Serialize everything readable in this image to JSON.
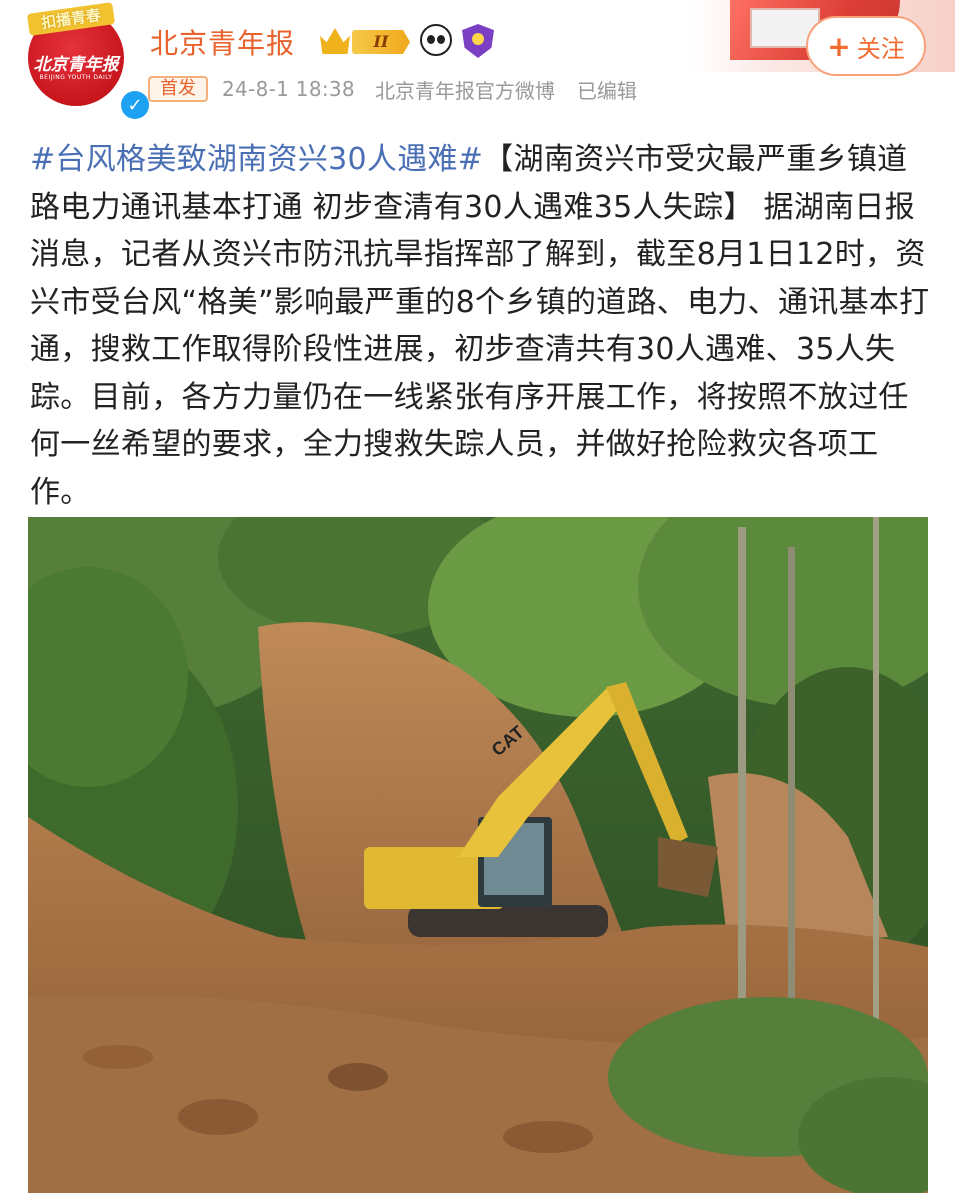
{
  "account": {
    "name": "北京青年报",
    "avatar_logo_text": "北京青年报",
    "avatar_sub": "BEIJING YOUTH DAILY",
    "avatar_tag": "扣播青春",
    "level": "II"
  },
  "follow": {
    "label": "关注",
    "plus": "+"
  },
  "meta": {
    "first_tag": "首发",
    "timestamp": "24-8-1 18:38",
    "source": "北京青年报官方微博",
    "edited": "已编辑"
  },
  "post": {
    "hashtag": "#台风格美致湖南资兴30人遇难#",
    "body": "【湖南资兴市受灾最严重乡镇道路电力通讯基本打通 初步查清有30人遇难35人失踪】 据湖南日报消息，记者从资兴市防汛抗旱指挥部了解到，截至8月1日12时，资兴市受台风“格美”影响最严重的8个乡镇的道路、电力、通讯基本打通，搜救工作取得阶段性进展，初步查清共有30人遇难、35人失踪。目前，各方力量仍在一线紧张有序开展工作，将按照不放过任何一丝希望的要求，全力搜救失踪人员，并做好抢险救灾各项工作。"
  },
  "photo": {
    "excavator_brand": "CAT",
    "colors": {
      "soil": "#b07a4a",
      "foliage": "#4f7a36",
      "excavator": "#e8c23a"
    }
  },
  "colors": {
    "username": "#e8632d",
    "hashtag": "#4a6fb5",
    "meta": "#999999",
    "follow_border": "#f7a27b",
    "verified": "#1da1f2"
  }
}
